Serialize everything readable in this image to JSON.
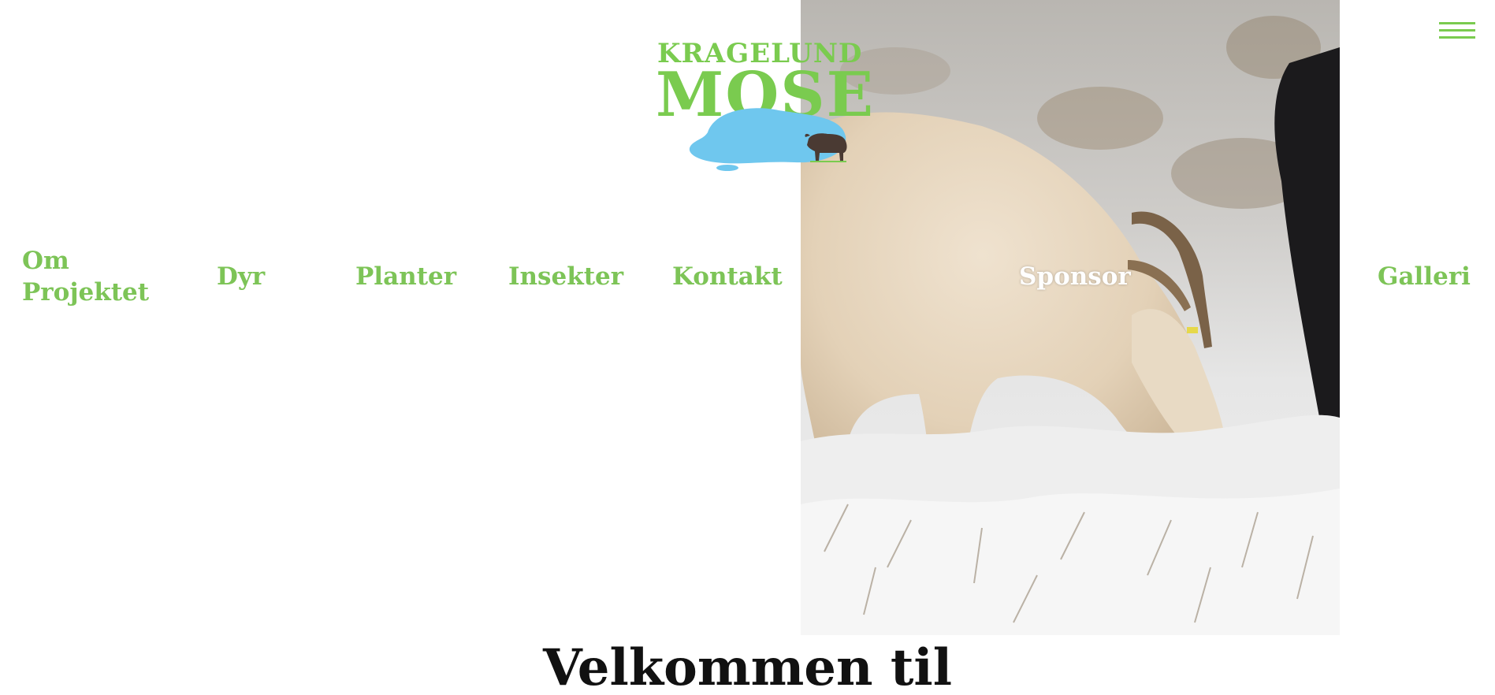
{
  "logo": {
    "line1": "KRAGELUND",
    "line2": "MOSE"
  },
  "nav": {
    "items": [
      {
        "label_line1": "Om",
        "label_line2": "Projektet"
      },
      {
        "label": "Dyr"
      },
      {
        "label": "Planter"
      },
      {
        "label": "Insekter"
      },
      {
        "label": "Kontakt"
      },
      {
        "label": "Sponsor"
      },
      {
        "label": "Galleri"
      }
    ]
  },
  "hero": {
    "heading": "Velkommen til"
  },
  "icons": {
    "menu": "hamburger-menu-icon",
    "logo_animal": "cattle-icon"
  },
  "colors": {
    "brand_green": "#7acb4f",
    "nav_green": "#7dc457",
    "water_blue": "#6fc7ee",
    "heading": "#111111"
  }
}
